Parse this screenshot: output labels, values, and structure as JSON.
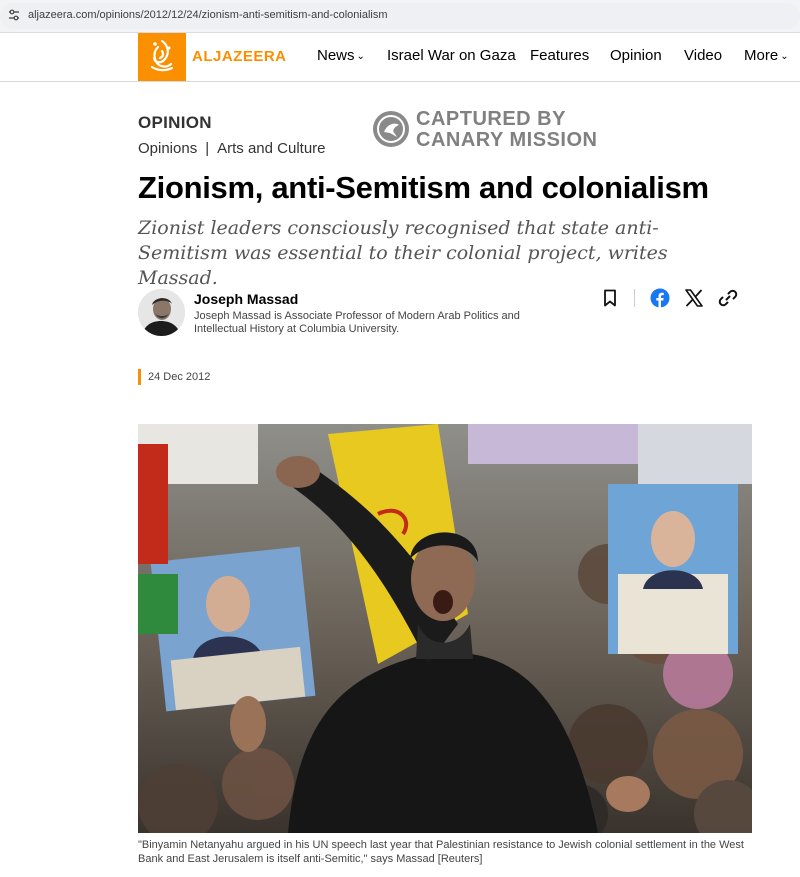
{
  "browser": {
    "url": "aljazeera.com/opinions/2012/12/24/zionism-anti-semitism-and-colonialism"
  },
  "header": {
    "logo_text": "ALJAZEERA",
    "brand_color": "#fa9000",
    "nav": [
      {
        "label": "News",
        "has_dropdown": true
      },
      {
        "label": "Israel War on Gaza",
        "has_dropdown": false
      },
      {
        "label": "Features",
        "has_dropdown": false
      },
      {
        "label": "Opinion",
        "has_dropdown": false
      },
      {
        "label": "Video",
        "has_dropdown": false
      },
      {
        "label": "More",
        "has_dropdown": true
      }
    ],
    "dropdown_glyph": "⌄"
  },
  "article": {
    "kicker": "OPINION",
    "breadcrumb": [
      "Opinions",
      "Arts and Culture"
    ],
    "breadcrumb_separator": "|",
    "title": "Zionism, anti-Semitism and colonialism",
    "subhead": "Zionist leaders consciously recognised that state anti-Semitism was essential to their colonial project, writes Massad.",
    "author": {
      "name": "Joseph Massad",
      "bio": "Joseph Massad is Associate Professor of Modern Arab Politics and Intellectual History at Columbia University."
    },
    "date": "24 Dec 2012",
    "image_caption": "\"Binyamin Netanyahu argued in his UN speech last year that Palestinian resistance to Jewish colonial settlement in the West Bank and East Jerusalem is itself anti-Semitic,\" says Massad [Reuters]"
  },
  "watermark": {
    "line1": "CAPTURED BY",
    "line2": "CANARY MISSION"
  },
  "share_icons": [
    "bookmark-icon",
    "facebook-icon",
    "x-icon",
    "link-icon"
  ],
  "colors": {
    "facebook": "#1877f2",
    "date_accent": "#fa9000"
  }
}
